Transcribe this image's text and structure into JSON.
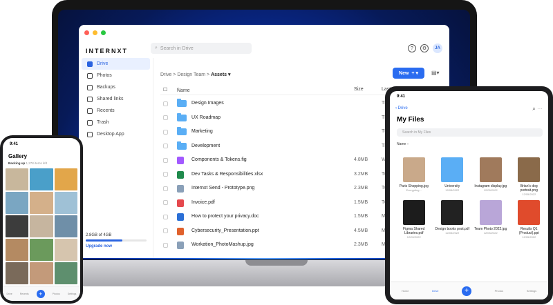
{
  "laptop": {
    "brand": "INTERNXT",
    "search_placeholder": "Search in Drive",
    "avatar": "JA",
    "sidebar": [
      {
        "label": "Drive",
        "active": true
      },
      {
        "label": "Photos"
      },
      {
        "label": "Backups"
      },
      {
        "label": "Shared links"
      },
      {
        "label": "Recents"
      },
      {
        "label": "Trash"
      },
      {
        "label": "Desktop App"
      }
    ],
    "usage": "2.8GB of 4GB",
    "upgrade": "Upgrade now",
    "breadcrumb": {
      "root": "Drive",
      "sep1": ">",
      "mid": "Design Team",
      "sep2": ">",
      "current": "Assets"
    },
    "new_button": "New",
    "columns": {
      "name": "Name",
      "size": "Size",
      "modified": "Last modification"
    },
    "rows": [
      {
        "name": "Design Images",
        "size": "",
        "date": "Thu 23",
        "type": "folder"
      },
      {
        "name": "UX Roadmap",
        "size": "",
        "date": "Thu 23",
        "type": "folder"
      },
      {
        "name": "Marketing",
        "size": "",
        "date": "Thu 23",
        "type": "folder"
      },
      {
        "name": "Development",
        "size": "",
        "date": "Thu 23",
        "type": "folder"
      },
      {
        "name": "Components & Tokens.fig",
        "size": "4.8MB",
        "date": "Wed 1",
        "type": "fig"
      },
      {
        "name": "Dev Tasks & Responsibilities.xlsx",
        "size": "3.2MB",
        "date": "Tue 9 J",
        "type": "xls"
      },
      {
        "name": "Internxt Send - Prototype.png",
        "size": "2.3MB",
        "date": "Tue 9 J",
        "type": "img"
      },
      {
        "name": "Invoice.pdf",
        "size": "1.5MB",
        "date": "Tue 9 J",
        "type": "pdf"
      },
      {
        "name": "How to protect your privacy.doc",
        "size": "1.5MB",
        "date": "Mon 8",
        "type": "doc"
      },
      {
        "name": "Cybersecurity_Presentation.ppt",
        "size": "4.5MB",
        "date": "Mon 8",
        "type": "ppt"
      },
      {
        "name": "Workation_PhotoMashup.jpg",
        "size": "2.3MB",
        "date": "Mon 8",
        "type": "img"
      }
    ]
  },
  "phone": {
    "time": "9:41",
    "title": "Gallery",
    "status": "Backing up",
    "status_detail": "1,278 items left",
    "tabs": [
      "Drive",
      "Recents",
      "",
      "Photos",
      "Settings"
    ]
  },
  "tablet": {
    "time": "9:41",
    "back": "Drive",
    "title": "My Files",
    "search_placeholder": "Search in My Files",
    "sort": "Name",
    "files": [
      {
        "name": "Paris Shopping.jpg",
        "meta": "Encrypting...",
        "color": "#c9a98a"
      },
      {
        "name": "University",
        "meta": "12/05/2022",
        "color": "#5aaef5"
      },
      {
        "name": "Instagram display.jpg",
        "meta": "12/05/2022",
        "color": "#a07a5c"
      },
      {
        "name": "Brian's dog portrait.png",
        "meta": "12/05/2022",
        "color": "#8a6a4a"
      },
      {
        "name": "Figma Shared Libraries.pdf",
        "meta": "12/05/2022",
        "color": "#1c1c1c"
      },
      {
        "name": "Design books post.pdf",
        "meta": "12/05/2022",
        "color": "#222"
      },
      {
        "name": "Team Photo 2022.jpg",
        "meta": "12/05/2022",
        "color": "#b9a6d8"
      },
      {
        "name": "Results Q1 (Product).ppt",
        "meta": "12/05/2022",
        "color": "#e04b2c"
      }
    ],
    "tabs": [
      "Home",
      "Drive",
      "",
      "Photos",
      "Settings"
    ]
  }
}
